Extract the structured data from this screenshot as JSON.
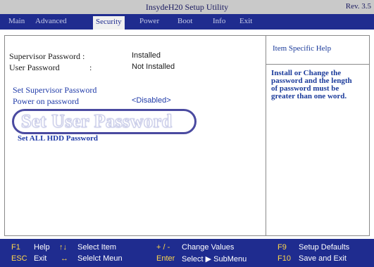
{
  "window": {
    "title": "InsydeH20 Setup Utility",
    "revision": "Rev. 3.5"
  },
  "menu": {
    "tabs": [
      {
        "label": "Main"
      },
      {
        "label": "Advanced"
      },
      {
        "label": "Security"
      },
      {
        "label": "Power"
      },
      {
        "label": "Boot"
      },
      {
        "label": "Info"
      },
      {
        "label": "Exit"
      }
    ],
    "active_tab": "Security"
  },
  "security": {
    "supervisor_password_label": "Supervisor Password :",
    "supervisor_password_value": "Installed",
    "user_password_label": "User Password",
    "user_password_colon": ":",
    "user_password_value": "Not Installed",
    "set_supervisor_password": "Set Supervisor Password",
    "power_on_password_label": "Power on password",
    "power_on_password_value": "<Disabled>",
    "set_user_password": "Set User Password",
    "set_all_hdd_password": "Set ALL HDD Password"
  },
  "help": {
    "title": "Item Specific Help",
    "lines": [
      "Install or Change the",
      "password and the length",
      "of password must be",
      "greater than one word."
    ]
  },
  "footer": {
    "row1": [
      {
        "key": "F1",
        "desc": "Help"
      },
      {
        "key": "↑↓",
        "desc": "Select Item"
      },
      {
        "key": "+ / -",
        "desc": "Change Values"
      },
      {
        "key": "F9",
        "desc": "Setup Defaults"
      }
    ],
    "row2": [
      {
        "key": "ESC",
        "desc": "Exit"
      },
      {
        "key": "↔",
        "desc": "Selelct Meun"
      },
      {
        "key": "Enter",
        "desc": "Select ▶ SubMenu"
      },
      {
        "key": "F10",
        "desc": "Save and Exit"
      }
    ]
  },
  "colors": {
    "menubar": "#1f2c8f",
    "footer": "#1f2c8f",
    "key": "#ffd84a",
    "highlight_ring": "#4a4aa0"
  }
}
